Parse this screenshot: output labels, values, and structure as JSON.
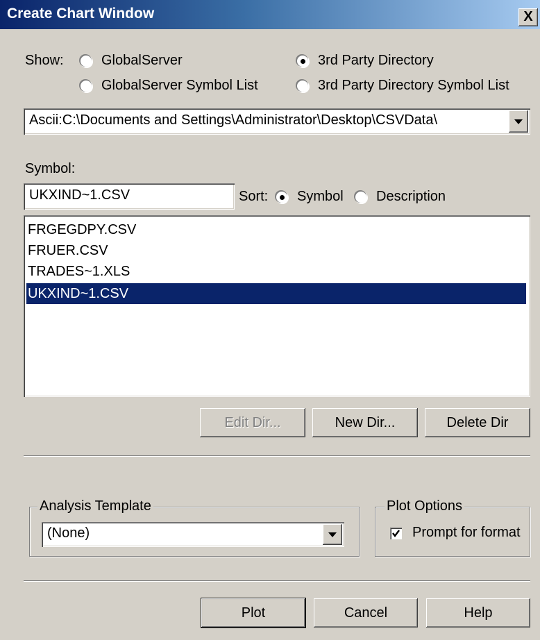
{
  "window": {
    "title": "Create Chart Window",
    "close_glyph": "X"
  },
  "show": {
    "label": "Show:",
    "options": [
      {
        "label": "GlobalServer",
        "selected": false
      },
      {
        "label": "GlobalServer Symbol List",
        "selected": false
      },
      {
        "label": "3rd Party Directory",
        "selected": true
      },
      {
        "label": "3rd Party Directory Symbol List",
        "selected": false
      }
    ]
  },
  "directory": {
    "value": "Ascii:C:\\Documents and Settings\\Administrator\\Desktop\\CSVData\\"
  },
  "symbol": {
    "label": "Symbol:",
    "value": "UKXIND~1.CSV"
  },
  "sort": {
    "label": "Sort:",
    "options": [
      {
        "label": "Symbol",
        "selected": true
      },
      {
        "label": "Description",
        "selected": false
      }
    ]
  },
  "files": {
    "items": [
      "FRGEGDPY.CSV",
      "FRUER.CSV",
      "TRADES~1.XLS",
      "UKXIND~1.CSV"
    ],
    "selected_index": 3
  },
  "dir_buttons": {
    "edit": "Edit Dir...",
    "new": "New Dir...",
    "delete": "Delete Dir"
  },
  "analysis_template": {
    "title": "Analysis Template",
    "value": "(None)"
  },
  "plot_options": {
    "title": "Plot Options",
    "prompt_label": "Prompt for format",
    "prompt_checked": true
  },
  "footer": {
    "plot": "Plot",
    "cancel": "Cancel",
    "help": "Help"
  },
  "colors": {
    "title_bar": "#0a246a",
    "selection": "#0a246a",
    "dialog_bg": "#d4d0c8"
  }
}
